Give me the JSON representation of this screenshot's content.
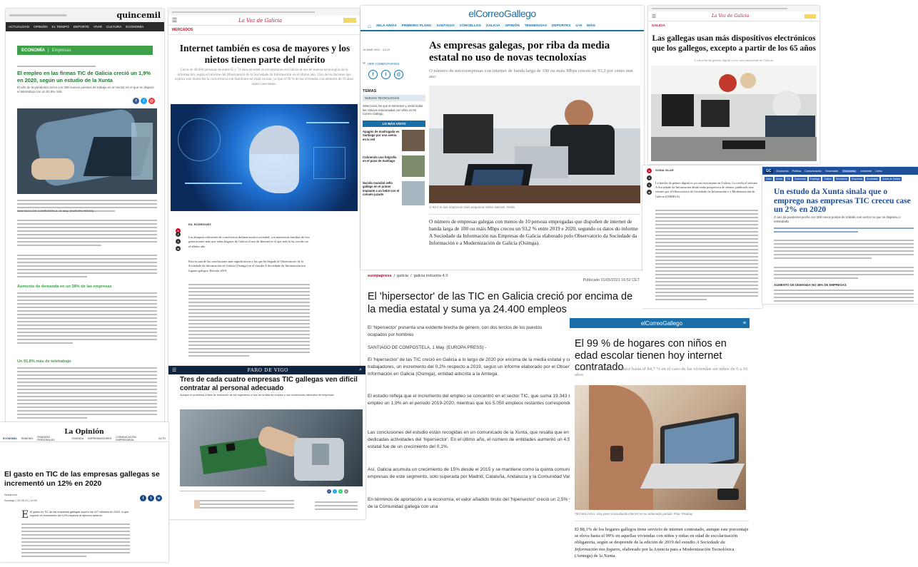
{
  "quincemil": {
    "logo": "quincemil",
    "nav": [
      "ACTUALIDAD",
      "OPINIÓN",
      "EL TIEMPO",
      "DEPORTE",
      "VIVIR",
      "CULTURA",
      "ECONOMÍA"
    ],
    "section_a": "ECONOMÍA",
    "section_b": "Empresas",
    "title": "El empleo en las firmas TIC de Galicia creció un 1,9% en 2020, según un estudio de la Xunta",
    "lead": "El año de la pandemia cierra con 269 nuevos puestos de trabajo en un sector en el que se disparó el teletrabajo con un 91,6% más",
    "dateline": "SANTIAGO DE COMPOSTELA, 01 May. (EUROPA PRESS) -",
    "sub1": "Aumento de demanda en un 38% de las empresas",
    "sub2": "Un 91,8% más de teletrabajo"
  },
  "voz1": {
    "logo": "La Voz de Galicia",
    "section": "MERCADOS",
    "title": "Internet también es cosa de mayores y los nietos tienen parte del mérito",
    "lead": "Cerca de 40.000 personas de entre 65 y 74 años de edad se incorporaron en Galicia al uso de nuevas tecnologías de la información, según el informe del Observatorio de la Sociedade da Información en el último año. Uno de los factores que explica este boom fue la convivencia con familiares en edad escolar, ya que el 90 % de las viviendas con menores de 16 años están conectadas."
  },
  "correo1": {
    "logo": "elCorreoGallego",
    "nav": [
      "XELA ARIAS",
      "PRIMEIRO PLANO",
      "SANTIAGO",
      "CONCELLOS",
      "GALICIA",
      "OPINIÓN",
      "TENDENCIAS",
      "DEPORTES",
      "U-H",
      "MÁIS"
    ],
    "date": "14 MAR 2021 · 13:19",
    "comments": "VER COMENTARIOS",
    "temas_label": "TEMAS",
    "temas_tag": "NUEVAS TECNOLOGÍAS",
    "temas_text": "Selecciona los que te interesen y verás todas las noticias relacionadas con ellos en Mi Correo Gallego.",
    "most_viewed": "LO MÁS VISTO",
    "mv_items": [
      "Apagón de madrugada en Santiago por una avería en la red",
      "Cubriendo una fotgrafía en el pazo de Santiago",
      "Nacido mundial sello gallego en el primer implante a un bebé con el conuén juzado"
    ],
    "title": "As empresas galegas, por riba da media estatal no uso de novas tecnoloxías",
    "lead": "O número de microempresas con internet de banda larga de 100 ou máis Mbps creceu un 93,2 por cento nun ano",
    "caption": "O 93,5 % das empresas máis pequenas teñen internet. Pixels",
    "body": "O número de empresas galegas con menos de 10 persoas empregadas que dispoñen de internet de banda larga de 100 ou máis Mbps creceu un 93,2 % entre 2019 e 2020, segundo os datos do informe A Sociedade da Información nas Empresas de Galicia elaborado polo Observatorio da Sociedade da Información e a Modernización de Galicia (Osimga)."
  },
  "voz2": {
    "logo": "La Voz de Galicia",
    "section": "GALICIA",
    "title": "Las gallegas usan más dispositivos electrónicos que los gallegos, excepto a partir de los 65 años",
    "lead": "La brecha de género digital ya es casi inexistente en Galicia"
  },
  "voz1b": {
    "author": "EA. RODRÍGUEZ",
    "body_a": "Las abruptas relaciones de convivencia definen nuestra sociedad, con numerosas familias de tres generaciones más que todas hogares de Galicia el uso de Internet es el que más lo ha crecido en el último año.",
    "body_b": "Esta es una de las conclusiones más significativas a las que ha llegado el Observatorio de la Sociedade da Información en Galicia (Osimga) en el estudio A Sociedade da Información nos fogares galegos. Edición 2019."
  },
  "voz2b": {
    "author": "SONIA VILAR",
    "body": "La brecha de género digital es ya casi inexistente en Galicia. Lo revela el informe A Sociedade da Información desde unha perspectiva de xénero, publicado este viernes por el Observatorio da Sociedade da Información e a Modernización de Galicia (OSIMGA)."
  },
  "xunta": {
    "logo": "GC",
    "nav": [
      "Economía",
      "Política",
      "Comunicación",
      "Sociedade",
      "Economía",
      "Ambiente",
      "Cienc"
    ],
    "tags": [
      "Inicio",
      "Xunta",
      "TIC",
      "Economía",
      "Emprego",
      "Galicia",
      "Tecnoloxía",
      "Empresas",
      "Sociedade",
      "Xunta de Galicia"
    ],
    "title": "Un estudo da Xunta sinala que o emprego nas empresas TIC creceu case un 2% en 2020",
    "lead": "O ano da pandemia pecha con 269 novos postos de traballo nun sector no que se disparou o teletraballo",
    "sub": "AUMENTO DE DEMANDA NO 38% DE EMPRESAS"
  },
  "ep": {
    "breadcrumb": [
      "europapress",
      "galicia",
      "galicia industria 4.0"
    ],
    "published": "Publicado 01/05/2021 16:52 CET",
    "title": "El 'hipersector' de las TIC en Galicia creció por encima de la media estatal y suma ya 24.400 empleos",
    "lead": "El 'hipersector' presenta una evidente brecha de género, con dos tercios de los puestos ocupados por hombres",
    "dateline": "SANTIAGO DE COMPOSTELA, 1 May. (EUROPA PRESS) -",
    "paras": [
      "El 'hipersector' de las TIC creció en Galicia a lo largo de 2020 por encima de la media estatal y cerró el año con 24.393 trabajadores, un incremento del 0,2% respecto a 2019, según un informe elaborado por el Observatorio da Sociedade da Información en Galicia (Osimga), entidad adscrita a la Amtega.",
      "El estudio refleja que el incremento del empleo se concentró en el sector TIC, que suma 19.343 trabajadores y creció en empleo un 1,9% en el periodo 2019-2020, mientras que los 5.050 empleos restantes corresponden al sector de contenidos.",
      "Las conclusiones del estudio están recogidas en un comunicado de la Xunta, que resalta que en 2019 había 3.830 empresas dedicadas actividades del 'hipersector'. En el último año, el número de entidades aumentó un 4,5% mientras que la media estatal fue de un crecimiento del 0,1%.",
      "Así, Galicia acumula un crecimiento de 15% desde el 2015 y se mantiene como la quinta comunidad autónoma en número de empresas de este segmento, solo superada por Madrid, Cataluña, Andalucía y la Comunidad Valenciana.",
      "En términos de aportación a la economía, el valor añadido bruto del 'hipersector' creció un 2,5% y representa ya el 2,8% del PIB de la Comunidad gallega con una"
    ]
  },
  "faro": {
    "logo": "FARO DE VIGO",
    "title": "Tres de cada cuatro empresas TIC gallegas ven difícil contratar al personal adecuado",
    "lead": "Aunque el problema a falta de formación de los ingenieros a raíz de la falta de empleo y sus condiciones laborales de empresas"
  },
  "opinion": {
    "logo": "La Opinión",
    "nav": [
      "ECONOMÍA",
      "RANKING",
      "FINANZAS PERSONALES",
      "VIVIENDA",
      "EMPRENDEDORES",
      "COMUNICACIÓN EMPRESARIAL",
      "ACTU"
    ],
    "title": "El gasto en TIC de las empresas gallegas se incrementó un 12% en 2020",
    "author": "Redacción",
    "date": "Santiago | 29·05·21 | 14:09",
    "body": "El gasto en TIC de las empresas gallegas superó los 417 millones en 2020, lo que supone un incremento del 12% respecto al ejercicio anterior."
  },
  "correo2": {
    "logo": "elCorreoGallego",
    "title": "El 99 % de hogares con niños en edad escolar tienen hoy internet contratado",
    "lead": "Esa cifra de Galicia se reduce hasta el 84,7 % en el caso de las viviendas sin niños de 6 a 16 años",
    "caption": "TECNOLOGÍA. Una joven consultando internet en su ordenador portátil. Foto: Pixabay",
    "body_a": "El 88,1% de los hogares gallegos tiene servicio de internet contratado, aunque este porcentaje se eleva hasta el 99% en aquellas viviendas con niños y niñas en edad de escolarización obligatoria, según se desprende de la edición de 2019 del estudio",
    "body_b": "A Sociedade da Información nos fogares,",
    "body_c": "elaborado por la Axencia para a Modernización Tecnolóxica (Amtega) de la Xunta."
  },
  "colors": {
    "quincemil_nav": "#2a2a2a",
    "quincemil_green": "#3ea14a",
    "correo_blue": "#1a6fa8",
    "voz_red": "#c8102e",
    "faro_navy": "#0d2340",
    "xunta_blue": "#1e4f9a"
  }
}
